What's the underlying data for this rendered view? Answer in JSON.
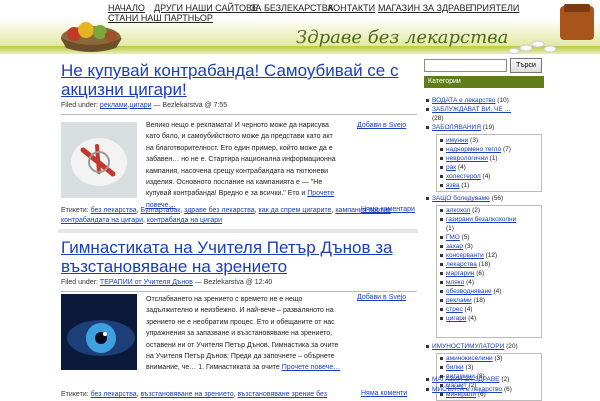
{
  "nav": {
    "items": [
      "НАЧАЛО",
      "ДРУГИ НАШИ САЙТОВЕ",
      "ЗА БЕЗЛЕКАРСТВА",
      "КОНТАКТИ",
      "МАГАЗИН ЗА ЗДРАВЕ",
      "ПРИЯТЕЛИ",
      "СТАНИ НАШ ПАРТНЬОР"
    ]
  },
  "brand": "Здраве без лекарства",
  "posts": [
    {
      "title": "Не купувай контрабанда! Самоубивай се с акцизни цигари!",
      "meta_prefix": "Filed under:",
      "category_links": [
        "реклами",
        "цигари"
      ],
      "meta_suffix": "— Bezlekarstva @ 7:55",
      "excerpt": "Велико нещо е рекламата! И черното може да нарисува като бяло, и самоубийството може да представи като акт на благотворителност. Ето един пример, който може да е забавен… но не е. Стартира национална информационна кампания, насочена срещу контрабандата на тютюневи изделия. Основното послание на кампанията е — \"Не купувай контрабанда! Вредно е за всички.\" Ето и",
      "more": "Прочете повече…",
      "svejo": "Добави в Svejo",
      "tags_label": "Етикети:",
      "tags": [
        "без лекарства",
        "Булгартабак",
        "здраве без лекарства",
        "как да спрем цигарите",
        "кампания против контрабандата на цигари",
        "контрабанда на цигари"
      ],
      "comments": "Няма коментари"
    },
    {
      "title": "Гимнастиката на Учителя Петър Дънов за възстановяване на зрението",
      "meta_prefix": "Filed under:",
      "category_links": [
        "ТЕРАПИИ от Учителя Дънов"
      ],
      "meta_suffix": "— Bezlekarstva @ 12:40",
      "excerpt": "Отслабването на зрението с времето не е нещо задължително и неизбежно. И най-вече – разваляното на зрението не е необратим процес. Ето и обещаните от нас упражнения за запазване и възстановяване на зрението, оставени ни от Учителя Петър Дънов. Гимнастика за очите на Учителя Петър Дънов: Преди да започнете – обърнете внимание, че… 1. Гимнастиката за очите",
      "more": "Прочете повече…",
      "svejo": "Добави в Svejo",
      "tags_label": "Етикети:",
      "tags": [
        "без лекарства",
        "възстановяване на зрението",
        "възстановяване зрение без"
      ],
      "comments": "Няма коменти"
    }
  ],
  "sidebar": {
    "search_placeholder": "",
    "search_button": "Търси",
    "categories_header": "Категории",
    "top_items": [
      {
        "label": "ВОДАТА е лекарство",
        "count": "(10)"
      },
      {
        "label": "ЗАБЛУЖДАВАТ ВИ, ЧЕ …",
        "count": ""
      },
      {
        "label": "",
        "count": "(28)"
      },
      {
        "label": "ЗАБОЛЯВАНИЯ",
        "count": "(19)"
      }
    ],
    "disease_items": [
      {
        "label": "имунни",
        "count": "(3)"
      },
      {
        "label": "наднормено тегло",
        "count": "(7)"
      },
      {
        "label": "неврологични",
        "count": "(1)"
      },
      {
        "label": "рак",
        "count": "(4)"
      },
      {
        "label": "холестерол",
        "count": "(4)"
      },
      {
        "label": "язва",
        "count": "(1)"
      }
    ],
    "health_header": {
      "label": "ЗАЩО боледуваме",
      "count": "(56)"
    },
    "health_items": [
      {
        "label": "алкохол",
        "count": "(2)"
      },
      {
        "label": "газирани безалкохолни",
        "count": ""
      },
      {
        "label": "",
        "count": "(1)"
      },
      {
        "label": "ГМО",
        "count": "(5)"
      },
      {
        "label": "захар",
        "count": "(3)"
      },
      {
        "label": "консерванти",
        "count": "(12)"
      },
      {
        "label": "лекарства",
        "count": "(18)"
      },
      {
        "label": "маргарин",
        "count": "(6)"
      },
      {
        "label": "мляко",
        "count": "(4)"
      },
      {
        "label": "обезводняване",
        "count": "(4)"
      },
      {
        "label": "реклами",
        "count": "(18)"
      },
      {
        "label": "стрес",
        "count": "(4)"
      },
      {
        "label": "цигари",
        "count": "(4)"
      }
    ],
    "immuno_header": {
      "label": "ИМУНОСТИМУЛАТОРИ",
      "count": "(20)"
    },
    "immuno_items": [
      {
        "label": "аминокиселини",
        "count": "(3)"
      },
      {
        "label": "билки",
        "count": "(3)"
      },
      {
        "label": "витамини",
        "count": "(8)"
      },
      {
        "label": "магнит",
        "count": "(2)"
      },
      {
        "label": "минерали",
        "count": "(6)"
      }
    ],
    "bottom_items": [
      {
        "label": "МАГАЗИН ЗА ЗДРАВЕ",
        "count": "(2)"
      },
      {
        "label": "МИСЪЛТА е лекарство",
        "count": "(6)"
      }
    ]
  }
}
